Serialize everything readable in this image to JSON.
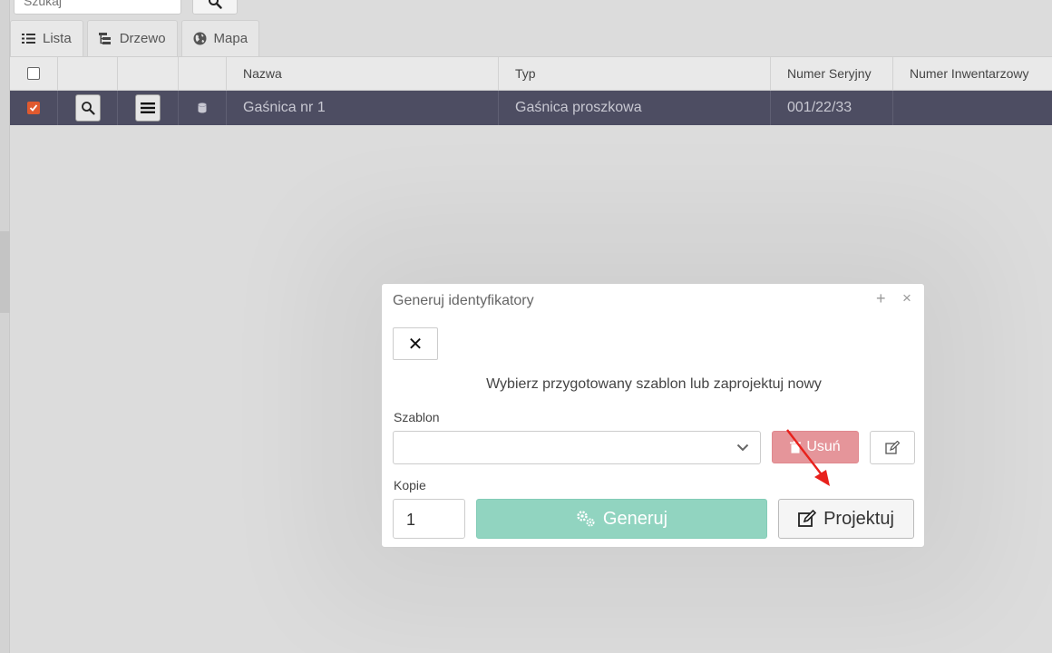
{
  "search": {
    "placeholder": "Szukaj"
  },
  "tabs": [
    {
      "label": "Lista",
      "icon": "list-icon"
    },
    {
      "label": "Drzewo",
      "icon": "tree-icon"
    },
    {
      "label": "Mapa",
      "icon": "globe-icon"
    }
  ],
  "table": {
    "columns": [
      "Nazwa",
      "Typ",
      "Numer Seryjny",
      "Numer Inwentarzowy"
    ],
    "rows": [
      {
        "selected": true,
        "nazwa": "Gaśnica nr 1",
        "typ": "Gaśnica proszkowa",
        "numer_seryjny": "001/22/33",
        "numer_inwentarzowy": ""
      }
    ]
  },
  "modal": {
    "title": "Generuj identyfikatory",
    "plus_symbol": "+",
    "close_symbol": "×",
    "close_button_symbol": "✕",
    "instruction": "Wybierz przygotowany szablon lub zaprojektuj nowy",
    "template_label": "Szablon",
    "template_value": "",
    "delete_label": "Usuń",
    "copies_label": "Kopie",
    "copies_value": "1",
    "generate_label": "Generuj",
    "design_label": "Projektuj"
  },
  "colors": {
    "row_selected": "#4d4d62",
    "checkbox_checked": "#e05a2f",
    "danger_disabled": "#e5959a",
    "success_disabled": "#91d4c0",
    "annotation_arrow": "#e8211c"
  }
}
